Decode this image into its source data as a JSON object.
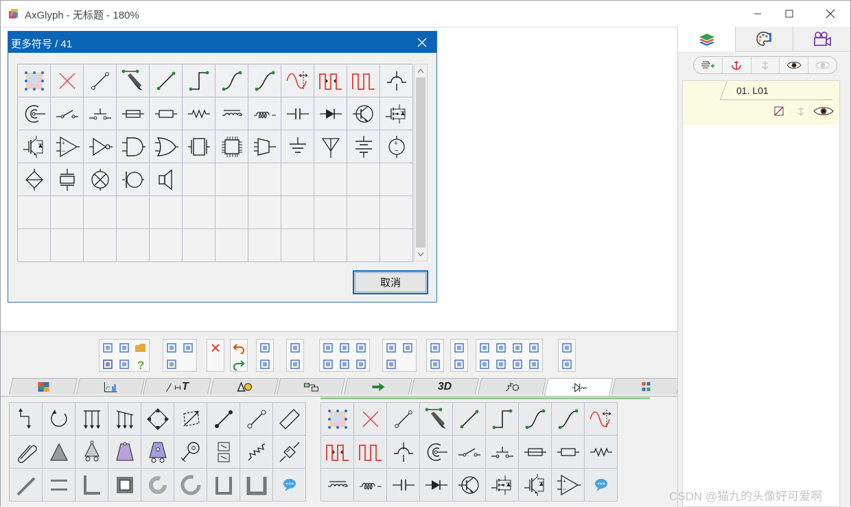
{
  "window": {
    "title": "AxGlyph - 无标题 - 180%",
    "minimize_icon": "minimize-icon",
    "maximize_icon": "maximize-icon",
    "close_icon": "close-icon"
  },
  "dialog": {
    "title": "更多符号 / 41",
    "cancel_label": "取消",
    "symbols": [
      "layer-select-icon",
      "delete-x-icon",
      "segment-icon",
      "pen-segment-icon",
      "line-segment-icon",
      "step-line-icon",
      "s-curve-icon",
      "smooth-curve-icon",
      "sine-wave-icon",
      "square-wave-red-icon",
      "square-wave-icon",
      "crossover-icon",
      "coil-c-icon",
      "switch-icon",
      "push-button-icon",
      "fuse-icon",
      "resistor-box-icon",
      "resistor-zigzag-icon",
      "inductor-icon",
      "coil-icon",
      "capacitor-icon",
      "diode-icon",
      "transistor-icon",
      "mosfet-icon",
      "igbt-icon",
      "op-amp-icon",
      "not-gate-icon",
      "and-gate-icon",
      "or-gate-icon",
      "crystal-icon",
      "chip-icon",
      "buffer-icon",
      "ground-icon",
      "antenna-icon",
      "battery-icon",
      "voltage-source-icon",
      "current-source-icon",
      "piezo-icon",
      "lamp-icon",
      "microphone-icon",
      "speaker-icon"
    ]
  },
  "toolbar": {
    "groups": [
      [
        "new-menu-icon",
        "new-doc-icon",
        "open-folder-icon",
        "save-icon",
        "settings-gear-icon",
        "help-icon"
      ],
      [
        "cut-icon",
        "copy-icon",
        "paste-icon"
      ],
      [
        "delete-icon"
      ],
      [
        "undo-icon",
        "redo-icon"
      ],
      [
        "grid-snap-icon",
        "node-snap-icon"
      ],
      [
        "rotate-icon",
        "flip-icon"
      ],
      [
        "align-left-icon",
        "align-center-icon",
        "align-right-icon",
        "align-top-icon",
        "align-middle-icon",
        "align-bottom-icon"
      ],
      [
        "same-width-icon",
        "same-height-icon",
        "center-page-icon"
      ],
      [
        "mirror-h-icon",
        "mirror-v-icon"
      ],
      [
        "bring-front-icon",
        "send-back-icon"
      ],
      [
        "distribute-h-icon",
        "distribute-v-icon",
        "space-h-icon",
        "space-v-icon",
        "equal-h-icon",
        "equal-v-icon",
        "equal-hs-icon",
        "equal-vs-icon"
      ],
      [
        "group-icon",
        "ungroup-icon"
      ]
    ]
  },
  "tabs": [
    {
      "id": "color",
      "icon": "palette-grid-icon",
      "label": ""
    },
    {
      "id": "chart",
      "icon": "chart-icon",
      "label": ""
    },
    {
      "id": "text",
      "icon": "line-text-dim-icon",
      "label": "T"
    },
    {
      "id": "shapes",
      "icon": "triangle-circle-icon",
      "label": ""
    },
    {
      "id": "flow",
      "icon": "flowchart-icon",
      "label": ""
    },
    {
      "id": "arrows",
      "icon": "arrow-icon",
      "label": ""
    },
    {
      "id": "3d",
      "icon": "",
      "label": "3D"
    },
    {
      "id": "mech",
      "icon": "spring-gear-icon",
      "label": ""
    },
    {
      "id": "circuit",
      "icon": "diode-inductor-icon",
      "label": ""
    },
    {
      "id": "more",
      "icon": "grid-4-icon",
      "label": ""
    }
  ],
  "left_palette": [
    "step-arrow-icon",
    "rotate-arrow-icon",
    "force-down-icon",
    "force-slant-icon",
    "diamond-arrows-icon",
    "parallelogram-arrows-icon",
    "link-bar-icon",
    "link-bar-open-icon",
    "slot-icon",
    "clip-icon",
    "fixed-support-icon",
    "roller-support-icon",
    "pendulum-icon",
    "cart-icon",
    "hook-icon",
    "box-slider-icon",
    "spring-icon",
    "damper-icon",
    "rod-icon",
    "parallel-bars-icon",
    "angle-block-icon",
    "square-block-icon",
    "ring-block-icon",
    "ring-large-icon",
    "u-block-icon",
    "u-block-wide-icon",
    "comment-icon"
  ],
  "right_palette": [
    "layer-select-icon",
    "delete-x-icon",
    "segment-icon",
    "pen-segment-icon",
    "line-segment-icon",
    "step-line-icon",
    "s-curve-icon",
    "smooth-curve-icon",
    "sine-wave-icon",
    "square-wave-red-icon",
    "square-wave-icon-2",
    "crossover-icon",
    "coil-c-icon",
    "switch-icon",
    "push-button-icon",
    "fuse-icon",
    "resistor-box-icon",
    "resistor-zigzag-icon",
    "inductor-icon",
    "coil-icon",
    "capacitor-icon",
    "diode-icon",
    "transistor-icon",
    "mosfet-icon",
    "igbt-icon",
    "op-amp-icon",
    "comment-icon"
  ],
  "right_panel": {
    "tabs": [
      "layers-icon",
      "style-palette-icon",
      "camera-icon"
    ],
    "layer_tools": [
      "add-layer-icon",
      "anchor-icon",
      "merge-down-icon",
      "show-all-icon",
      "hide-all-icon"
    ],
    "layer": {
      "name": "01. L01"
    }
  },
  "watermark": "CSDN @猫九的头像好可爱啊"
}
